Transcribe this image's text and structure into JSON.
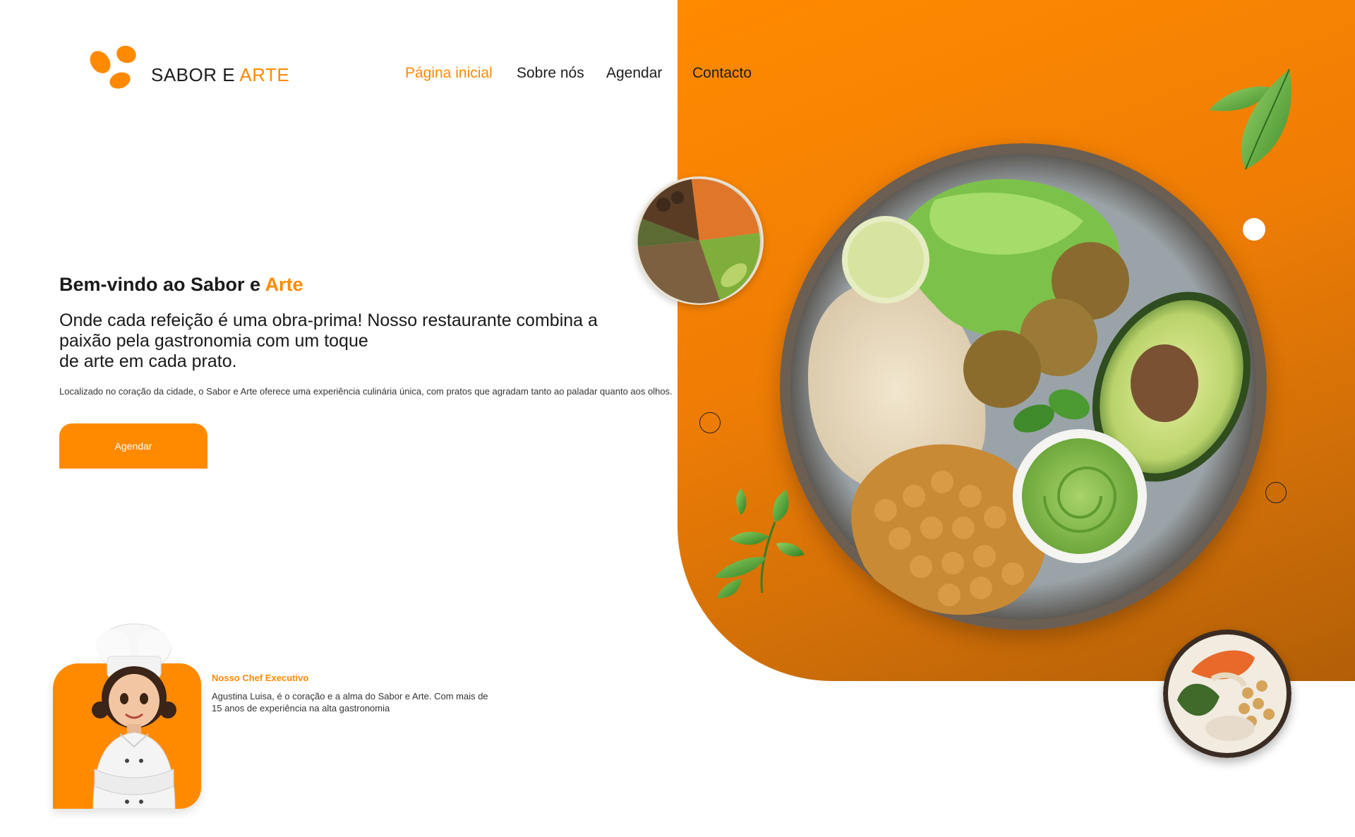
{
  "brand": {
    "name_part1": "SABOR E ",
    "name_part2": "ARTE"
  },
  "nav": [
    {
      "label": "Página inicial",
      "active": true
    },
    {
      "label": "Sobre nós",
      "active": false
    },
    {
      "label": "Agendar",
      "active": false
    },
    {
      "label": "Contacto",
      "active": false
    }
  ],
  "hero": {
    "welcome_part1": "Bem-vindo ao Sabor e ",
    "welcome_part2": "Arte",
    "headline_line1": "Onde cada refeição é uma obra-prima! Nosso restaurante combina a",
    "headline_line2": "paixão pela gastronomia com um toque",
    "headline_line3": "de arte em cada prato.",
    "description": "Localizado no coração da cidade, o Sabor e Arte oferece uma experiência culinária única, com pratos que agradam tanto ao paladar quanto aos olhos.",
    "cta_label": "Agendar"
  },
  "chef": {
    "title": "Nosso Chef Executivo",
    "description": "Agustina Luisa, é o coração e a alma do Sabor e Arte. Com mais de 15 anos de experiência na alta gastronomia"
  },
  "colors": {
    "accent": "#ff8a00",
    "text": "#1a1a1a",
    "background": "#ffffff"
  }
}
